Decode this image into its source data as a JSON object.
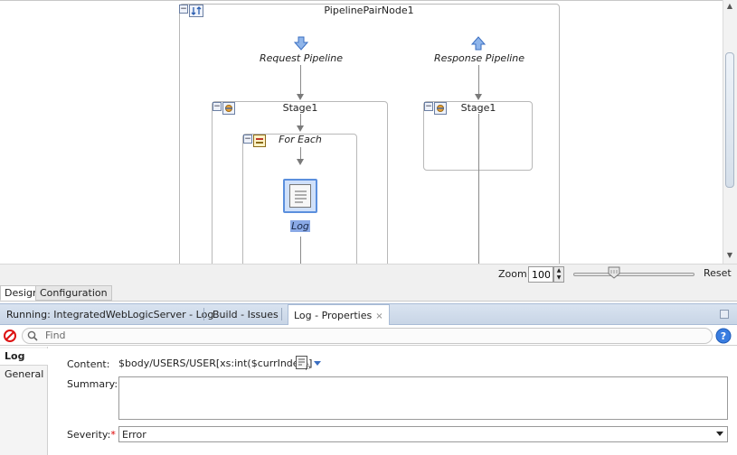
{
  "canvas": {
    "pipeline_pair_node": "PipelinePairNode1",
    "request_pipeline": "Request Pipeline",
    "response_pipeline": "Response Pipeline",
    "request_stage": "Stage1",
    "response_stage": "Stage1",
    "for_each": "For Each",
    "log_action": "Log"
  },
  "zoom": {
    "label": "Zoom:",
    "value": "100",
    "reset_label": "Reset"
  },
  "design_tabs": [
    "Design",
    "Configuration"
  ],
  "panel_tabs": [
    {
      "label": "Running: IntegratedWebLogicServer - Log"
    },
    {
      "label": "Build - Issues"
    },
    {
      "label": "Log - Properties",
      "close": "×"
    }
  ],
  "find": {
    "placeholder": "Find"
  },
  "side_nav": [
    "Log",
    "General"
  ],
  "properties": {
    "content_label": "Content:",
    "content_value": "$body/USERS/USER[xs:int($currIndex)]",
    "summary_label": "Summary:",
    "severity_label": "Severity:",
    "severity_required": "*",
    "severity_value": "Error"
  },
  "colors": {
    "accent_blue": "#3b7bd6",
    "panel_tab_bg": "#d2deee",
    "selection_bg": "#8aa9e6"
  },
  "icons": {
    "pipeline_pair": "pipeline-pair-icon",
    "request_arrow": "down-arrow-icon",
    "response_arrow": "up-arrow-icon",
    "stage": "stage-icon",
    "for_each": "for-each-icon",
    "log": "log-document-icon",
    "cancel": "cancel-icon",
    "search": "search-icon",
    "help": "help-icon",
    "xpath_editor": "xpath-editor-icon"
  }
}
